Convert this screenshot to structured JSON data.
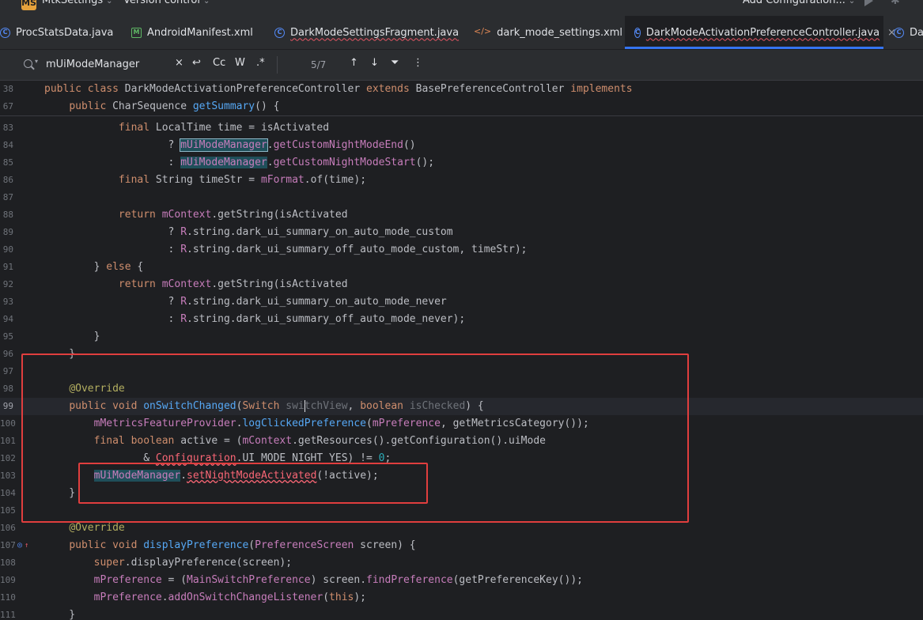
{
  "toolbar": {
    "project_badge": "MS",
    "project_name": "MtkSettings",
    "vcs_label": "Version control",
    "run_config_label": "Add Configuration..."
  },
  "tabs": [
    {
      "label": "ProcStatsData.java",
      "icon": "class-icon",
      "active": false
    },
    {
      "label": "AndroidManifest.xml",
      "icon": "manifest-icon",
      "active": false
    },
    {
      "label": "DarkModeSettingsFragment.java",
      "icon": "class-icon",
      "active": false
    },
    {
      "label": "dark_mode_settings.xml",
      "icon": "xml-icon",
      "active": false
    },
    {
      "label": "DarkModeActivationPreferenceController.java",
      "icon": "class-icon",
      "active": true
    },
    {
      "label": "Da",
      "icon": "class-icon",
      "active": false
    }
  ],
  "search": {
    "query": "mUiModeManager",
    "match_case_label": "Cc",
    "words_label": "W",
    "regex_label": ".*",
    "match_count": "5/7"
  },
  "colors": {
    "background": "#1e1f22",
    "keyword": "#cf8e6d",
    "function": "#56a8f5",
    "field": "#c77dbb",
    "annotation": "#b3ae60",
    "highlight_box": "#e03e3e",
    "active_tab_accent": "#3574f0"
  },
  "editor": {
    "current_line": "99",
    "lines": [
      {
        "n": "38",
        "sticky": true,
        "html": "<span class='kw'>public class</span> DarkModeActivationPreferenceController <span class='kw'>extends</span> BasePreferenceController <span class='kw'>implements</span>"
      },
      {
        "n": "67",
        "sticky": true,
        "html": "    <span class='kw'>public</span> CharSequence <span class='fn'>getSummary</span>() {"
      },
      {
        "n": "83",
        "html": "            <span class='kw'>final</span> LocalTime time = isActivated"
      },
      {
        "n": "84",
        "html": "                    ? <span class='hl hlbox'>mUiModeManager</span>.<span class='fld'>getCustomNightModeEnd</span>()"
      },
      {
        "n": "85",
        "html": "                    : <span class='hl'>mUiModeManager</span>.<span class='fld'>getCustomNightModeStart</span>();"
      },
      {
        "n": "86",
        "html": "            <span class='kw'>final</span> String timeStr = <span class='fld'>mFormat</span>.of(time);"
      },
      {
        "n": "87",
        "html": ""
      },
      {
        "n": "88",
        "html": "            <span class='kw'>return</span> <span class='fld'>mContext</span>.getString(isActivated"
      },
      {
        "n": "89",
        "html": "                    ? <span class='fld'>R</span>.string.dark_ui_summary_on_auto_mode_custom"
      },
      {
        "n": "90",
        "html": "                    : <span class='fld'>R</span>.string.dark_ui_summary_off_auto_mode_custom, timeStr);"
      },
      {
        "n": "91",
        "html": "        } <span class='kw'>else</span> {"
      },
      {
        "n": "92",
        "html": "            <span class='kw'>return</span> <span class='fld'>mContext</span>.getString(isActivated"
      },
      {
        "n": "93",
        "html": "                    ? <span class='fld'>R</span>.string.dark_ui_summary_on_auto_mode_never"
      },
      {
        "n": "94",
        "html": "                    : <span class='fld'>R</span>.string.dark_ui_summary_off_auto_mode_never);"
      },
      {
        "n": "95",
        "html": "        }"
      },
      {
        "n": "96",
        "html": "    }"
      },
      {
        "n": "97",
        "html": ""
      },
      {
        "n": "98",
        "html": "    <span class='an'>@Override</span>"
      },
      {
        "n": "99",
        "current": true,
        "html": "    <span class='kw'>public void</span> <span class='fn'>onSwitchChanged</span>(<span class='kw'>Switch</span> <span class='unused'>swi<span class='caret'></span>tchView</span>, <span class='kw'>boolean</span> <span class='unused'>isChecked</span>) {"
      },
      {
        "n": "100",
        "html": "        <span class='fld'>mMetricsFeatureProvider</span>.<span class='fn'>logClickedPreference</span>(<span class='fld'>mPreference</span>, getMetricsCategory());"
      },
      {
        "n": "101",
        "html": "        <span class='kw'>final boolean</span> active = (<span class='fld'>mContext</span>.getResources().getConfiguration().uiMode"
      },
      {
        "n": "102",
        "html": "                &amp; <span class='err'>Configuration</span>.UI_MODE_NIGHT_YES) != <span class='num'>0</span>;"
      },
      {
        "n": "103",
        "html": "        <span class='hl'>mUiModeManager</span>.<span class='err'>setNightModeActivated</span>(!active);"
      },
      {
        "n": "104",
        "html": "    }"
      },
      {
        "n": "105",
        "html": ""
      },
      {
        "n": "106",
        "html": "    <span class='an'>@Override</span>"
      },
      {
        "n": "107",
        "gutter_icons": true,
        "html": "    <span class='kw'>public void</span> <span class='fn'>displayPreference</span>(<span class='fld'>PreferenceScreen</span> screen) {"
      },
      {
        "n": "108",
        "html": "        <span class='kw'>super</span>.displayPreference(screen);"
      },
      {
        "n": "109",
        "html": "        <span class='fld'>mPreference</span> = (<span class='fld'>MainSwitchPreference</span>) screen.<span class='fld'>findPreference</span>(getPreferenceKey());"
      },
      {
        "n": "110",
        "html": "        <span class='fld'>mPreference</span>.<span class='fld'>addOnSwitchChangeListener</span>(<span class='kw'>this</span>);"
      },
      {
        "n": "111",
        "html": "    }"
      }
    ]
  }
}
